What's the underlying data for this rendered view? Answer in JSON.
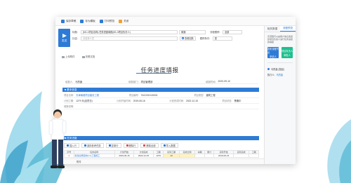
{
  "toolbar": {
    "items": [
      {
        "label": "保存草稿",
        "icon": "save-icon"
      },
      {
        "label": "存为模板",
        "icon": "template-icon"
      },
      {
        "label": "打印预览",
        "icon": "print-icon"
      },
      {
        "label": "关闭",
        "icon": "close-icon"
      }
    ]
  },
  "send": {
    "label": "发送",
    "icon": "paper-plane-icon"
  },
  "header": {
    "title_label": "标题:",
    "title_value": "(M1-1项目名称)-任务进度填报(M1-3项目负责人)",
    "copy_label": "抄送:",
    "copy_placeholder": "请选择人员",
    "urgency_value": "普通",
    "tracking_label": "流程跟踪:",
    "tracking_value": "全部",
    "receipt_button": "查看回执",
    "cond_label": "跟踪条件:",
    "cond_value": "是",
    "options_value": "全部"
  },
  "attach": {
    "upload": "上传附件",
    "related": "关联文档"
  },
  "form": {
    "title": "任务进度填报",
    "applicant_label": "填报人:",
    "applicant_value": "马烈鑫",
    "dept_label": "填报部门:",
    "dept_value": "项目管理部",
    "date_label": "填报时间:",
    "date_value": "2020-09-10"
  },
  "section1": {
    "head": "■ 基本信息",
    "rows": [
      [
        {
          "label": "项目名称:",
          "value": "天津南堤项目建设工程",
          "link": true
        },
        {
          "label": "项目编号:",
          "value": "TAC2019-00001",
          "link": false
        },
        {
          "label": "项目类型:",
          "value": "建筑工程",
          "link": false
        }
      ],
      [
        {
          "label": "计划工期:",
          "value": "1279 天(自然日)",
          "link": false
        },
        {
          "label": "计划开始时间:",
          "value": "2019-06-16",
          "link": false
        },
        {
          "label": "计划完成时间:",
          "value": "2022-12-15",
          "link": false
        },
        {
          "label": "项目状态:",
          "value": "策略中",
          "link": false
        }
      ],
      [
        {
          "label": "填报说明:",
          "value": "",
          "link": false
        }
      ]
    ]
  },
  "section2": {
    "head": "■ 任务进度",
    "buttons": [
      {
        "label": "插入行",
        "color": "#2e7bd6"
      },
      {
        "label": "选择参考任务",
        "color": "#2e7bd6"
      },
      {
        "label": "复制行",
        "color": "#2e7bd6"
      },
      {
        "label": "删除行",
        "color": "#e04b4b"
      },
      {
        "label": "删除全部",
        "color": "#e04b4b"
      },
      {
        "label": "导入数据",
        "color": "#2e7bd6"
      }
    ],
    "columns": [
      "序号",
      "任务名称",
      "计划开始",
      "计划完成",
      "工期",
      "实际工期",
      "完成比例",
      "本期",
      "累计",
      "实际开始",
      "实际完成",
      "工期"
    ],
    "rows": [
      [
        "1",
        "新建房屋结构(C1)工程施工",
        "2019-06-16",
        "2022-12-15",
        "1279",
        "10",
        "",
        "",
        "",
        "2019-06-16",
        "",
        ""
      ]
    ]
  },
  "footer": {
    "label": "附件"
  },
  "side": {
    "tabs": [
      "相关数据",
      "流程预览"
    ],
    "desc": "该流程可以由客户信息发送给项目负责人进行任务进度的填报",
    "btn1": {
      "line1": "发布流程节点",
      "line2": "申请人"
    },
    "btn2": {
      "line1": "项目负责人",
      "line2": "审批人"
    },
    "line1": "马烈鑫 [发起]",
    "line2_label": "执行人:",
    "line2_value": "马烈鑫"
  }
}
